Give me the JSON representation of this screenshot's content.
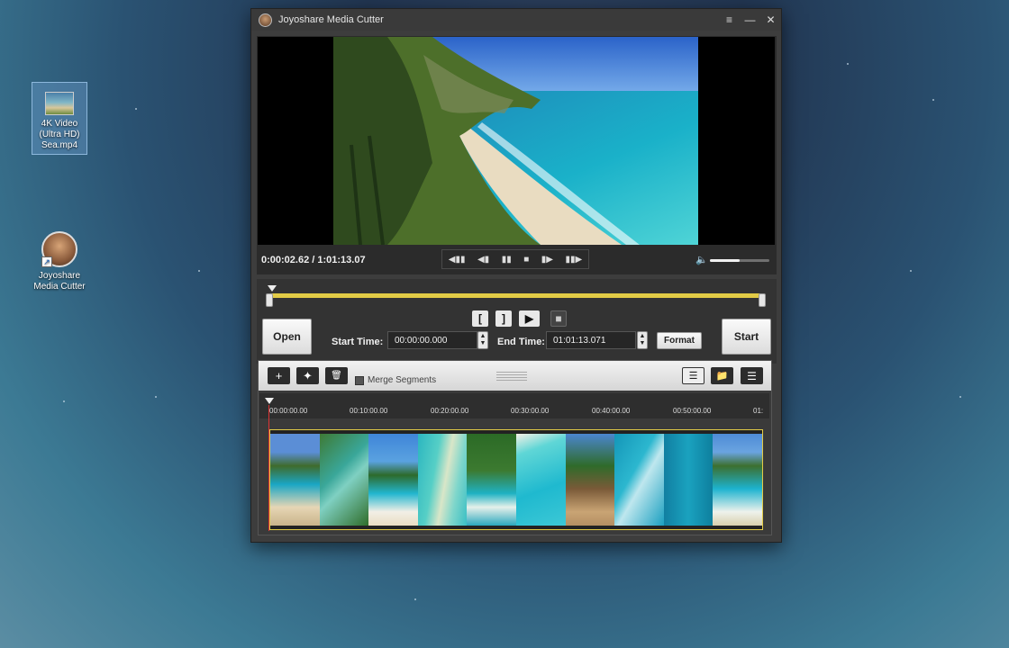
{
  "desktop": {
    "icons": [
      {
        "label": "4K Video (Ultra HD) Sea.mp4",
        "icon": "video-file-icon"
      },
      {
        "label": "Joyoshare Media Cutter",
        "icon": "app-shortcut-icon"
      }
    ]
  },
  "window": {
    "title": "Joyoshare Media Cutter",
    "menu_glyph": "≡",
    "min_glyph": "—",
    "close_glyph": "✕"
  },
  "player": {
    "time": "0:00:02.62 / 1:01:13.07",
    "controls": [
      "◀▮▮",
      "◀▮",
      "▮▮",
      "■",
      "▮▶",
      "▮▮▶"
    ],
    "volume_level": 0.5
  },
  "editor": {
    "open_label": "Open",
    "start_label": "Start",
    "start_time_label": "Start Time:",
    "start_time_value": "00:00:00.000",
    "end_time_label": "End Time:",
    "end_time_value": "01:01:13.071",
    "format_label": "Format",
    "mark_in_glyph": "[",
    "mark_out_glyph": "]",
    "play_segment_glyph": "▶",
    "stop_glyph": "■"
  },
  "timeline": {
    "add_glyph": "+",
    "effects_glyph": "✦",
    "delete_glyph": "🗑",
    "merge_label": "Merge Segments",
    "ticks": [
      "00:00:00.00",
      "00:10:00.00",
      "00:20:00.00",
      "00:30:00.00",
      "00:40:00.00",
      "00:50:00.00",
      "01:"
    ],
    "thumbnails": [
      "beach-cliff",
      "aerial-reef",
      "palm-beach",
      "aerial-shore",
      "palm-coast",
      "aerial-lagoon",
      "palm-sand",
      "aerial-waves",
      "aerial-deep",
      "beach-hills"
    ]
  }
}
